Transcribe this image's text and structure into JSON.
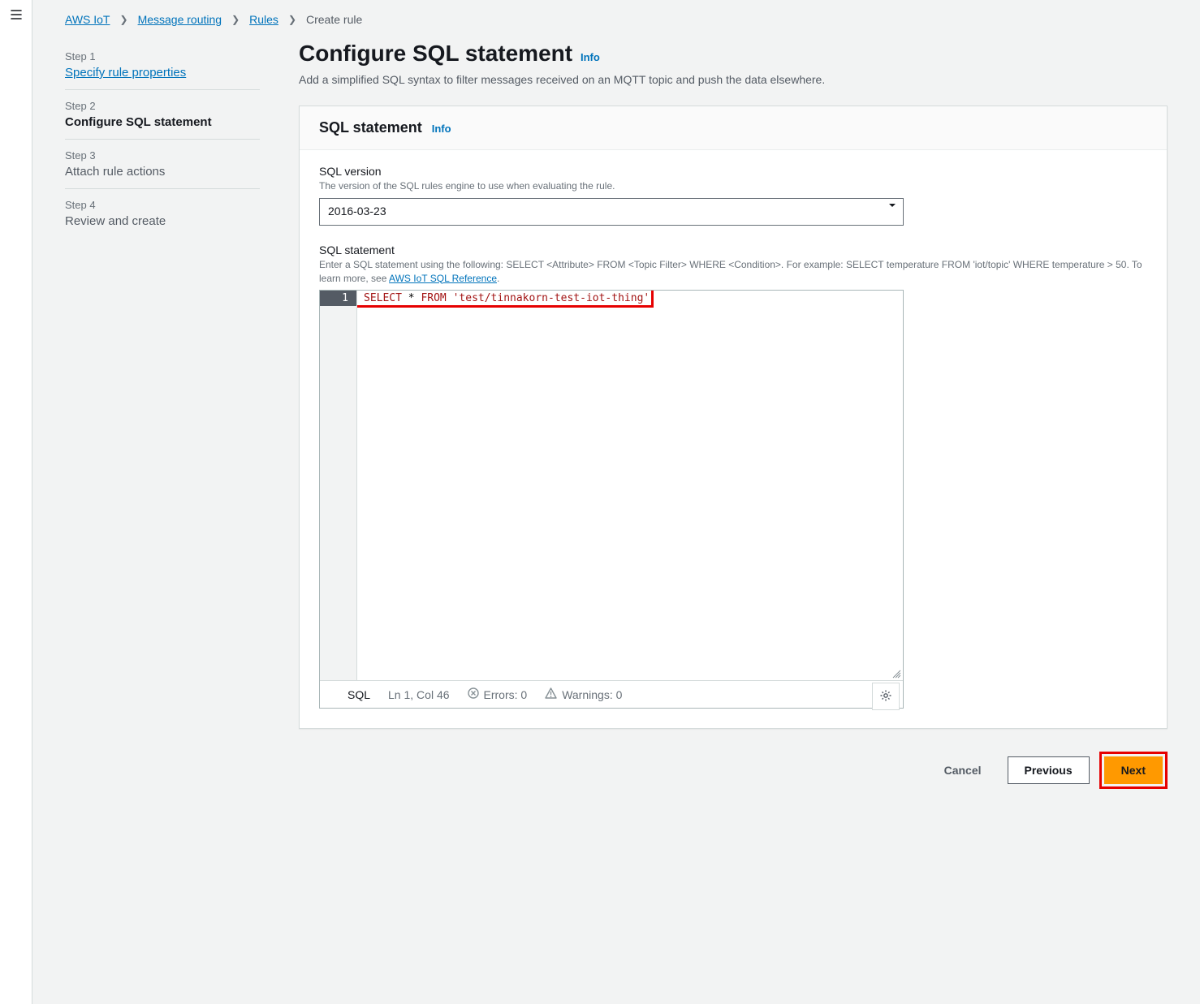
{
  "breadcrumbs": {
    "items": [
      {
        "label": "AWS IoT",
        "link": true
      },
      {
        "label": "Message routing",
        "link": true
      },
      {
        "label": "Rules",
        "link": true
      },
      {
        "label": "Create rule",
        "link": false
      }
    ]
  },
  "steps": [
    {
      "n": "Step 1",
      "title": "Specify rule properties",
      "state": "link"
    },
    {
      "n": "Step 2",
      "title": "Configure SQL statement",
      "state": "current"
    },
    {
      "n": "Step 3",
      "title": "Attach rule actions",
      "state": "future"
    },
    {
      "n": "Step 4",
      "title": "Review and create",
      "state": "future"
    }
  ],
  "page": {
    "title": "Configure SQL statement",
    "info": "Info",
    "subtitle": "Add a simplified SQL syntax to filter messages received on an MQTT topic and push the data elsewhere."
  },
  "panel": {
    "title": "SQL statement",
    "info": "Info"
  },
  "sql_version": {
    "label": "SQL version",
    "desc": "The version of the SQL rules engine to use when evaluating the rule.",
    "value": "2016-03-23"
  },
  "sql_stmt": {
    "label": "SQL statement",
    "desc_prefix": "Enter a SQL statement using the following: SELECT <Attribute> FROM <Topic Filter> WHERE <Condition>. For example: SELECT temperature FROM 'iot/topic' WHERE temperature > 50. To learn more, see ",
    "desc_link": "AWS IoT SQL Reference",
    "desc_suffix": ".",
    "code_tokens": {
      "select": "SELECT",
      "star": " * ",
      "from": "FROM",
      "space": " ",
      "topic": "'test/tinnakorn-test-iot-thing'"
    },
    "line_number": "1"
  },
  "editor_status": {
    "lang": "SQL",
    "pos": "Ln 1, Col 46",
    "errors": "Errors: 0",
    "warnings": "Warnings: 0"
  },
  "footer": {
    "cancel": "Cancel",
    "previous": "Previous",
    "next": "Next"
  }
}
